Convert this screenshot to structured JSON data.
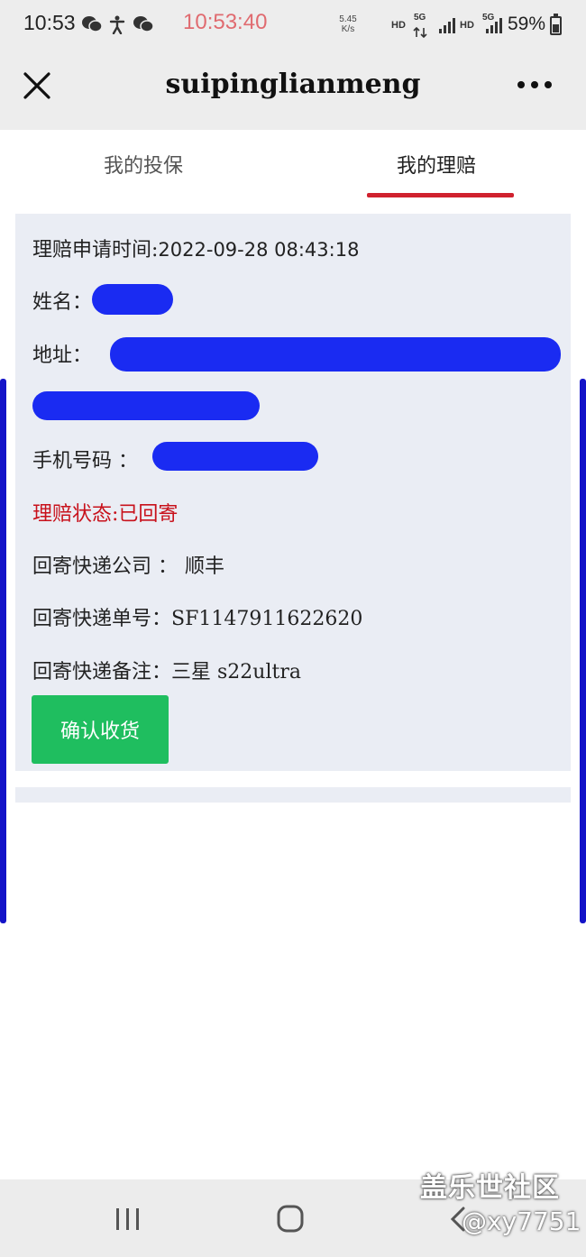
{
  "status_bar": {
    "time": "10:53",
    "clock_overlay": "10:53:40",
    "net_speed_value": "5.45",
    "net_speed_unit": "K/s",
    "hd_1": "HD",
    "fiveg_1": "5G",
    "hd_2": "HD",
    "fiveg_2": "5G",
    "battery": "59%",
    "battery_level": 0.59,
    "icons": [
      "wechat-icon",
      "accessibility-icon",
      "wechat-icon",
      "signal-icon",
      "signal-icon",
      "battery-icon"
    ]
  },
  "nav": {
    "title": "suipinglianmeng",
    "icons": [
      "close-icon",
      "more-icon"
    ]
  },
  "tabs": [
    {
      "label": "我的投保",
      "active": false
    },
    {
      "label": "我的理赔",
      "active": true
    }
  ],
  "claim": {
    "apply_time_label": "理赔申请时间:",
    "apply_time_value": "2022-09-28 08:43:18",
    "name_label": "姓名：",
    "address_label": "地址：",
    "phone_label": "手机号码 ：",
    "status_text": "理赔状态:已回寄",
    "express_company_label": "回寄快递公司 ：",
    "express_company_value": "顺丰",
    "express_no_label": "回寄快递单号：",
    "express_no_value": "SF1147911622620",
    "express_note_label": "回寄快递备注：",
    "express_note_value": "三星 s22ultra",
    "confirm_button": "确认收货"
  },
  "colors": {
    "accent_red": "#d0212e",
    "status_red": "#c8111b",
    "button_green": "#1fbe5f",
    "card_bg": "#eaedf4",
    "redaction_blue": "#1a2bf2"
  },
  "system_nav": {
    "icons": [
      "recent-apps-icon",
      "home-icon",
      "back-icon"
    ]
  },
  "watermark": {
    "line1": "盖乐世社区",
    "line2": "@xy7751"
  }
}
